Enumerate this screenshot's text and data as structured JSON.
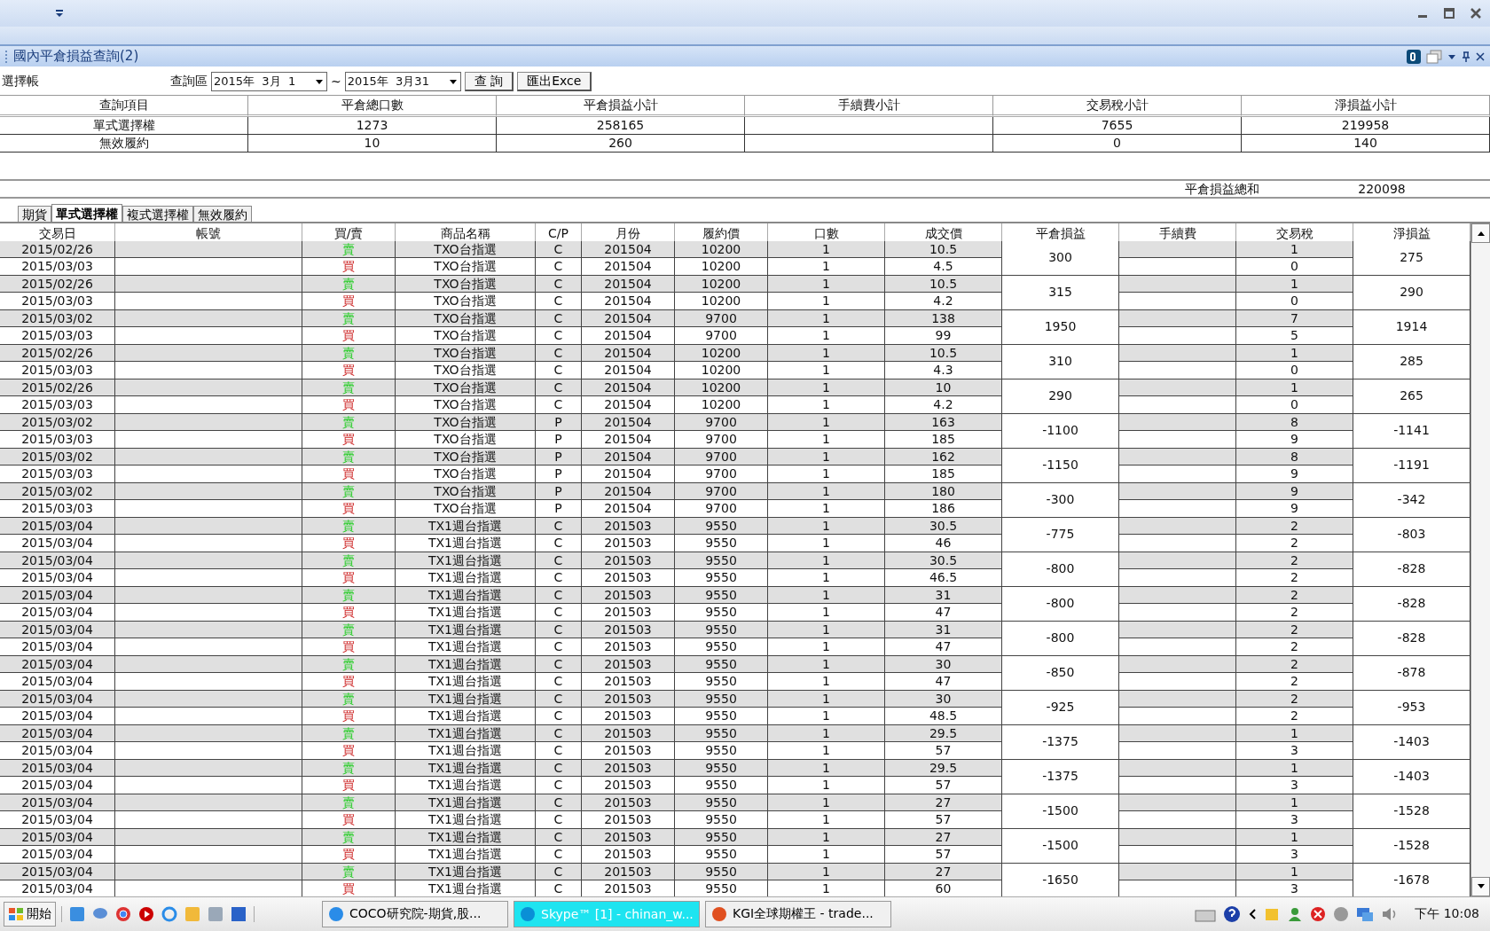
{
  "panel": {
    "title": "國內平倉損益查詢(2)"
  },
  "filter": {
    "account_label": "選擇帳",
    "range_label": "查詢區",
    "date_from": "2015年  3月  1",
    "range_sep": "~",
    "date_to": "2015年  3月31",
    "query_button": "查 詢",
    "export_button": "匯出Exce"
  },
  "summary": {
    "columns": [
      "查詢項目",
      "平倉總口數",
      "平倉損益小計",
      "手續費小計",
      "交易稅小計",
      "淨損益小計"
    ],
    "rows": [
      {
        "item": "單式選擇權",
        "lots": "1273",
        "pl": "258165",
        "tax": "7655",
        "net": "219958"
      },
      {
        "item": "無效履約",
        "lots": "10",
        "pl": "260",
        "tax": "0",
        "net": "140"
      }
    ]
  },
  "total": {
    "label": "平倉損益總和",
    "value": "220098"
  },
  "tabs": [
    {
      "label": "期貨",
      "selected": false
    },
    {
      "label": "單式選擇權",
      "selected": true
    },
    {
      "label": "複式選擇權",
      "selected": false
    },
    {
      "label": "無效履約",
      "selected": false
    }
  ],
  "detail": {
    "columns": [
      "交易日",
      "帳號",
      "買/賣",
      "商品名稱",
      "C/P",
      "月份",
      "履約價",
      "口數",
      "成交價",
      "平倉損益",
      "手續費",
      "交易稅",
      "淨損益"
    ],
    "pairs": [
      {
        "pl": "300",
        "net": "275",
        "legs": [
          {
            "date": "2015/02/26",
            "side": "賣",
            "kind": "sell",
            "product": "TXO台指選",
            "cp": "C",
            "month": "201504",
            "strike": "10200",
            "qty": "1",
            "price": "10.5",
            "tax": "1"
          },
          {
            "date": "2015/03/03",
            "side": "買",
            "kind": "buy",
            "product": "TXO台指選",
            "cp": "C",
            "month": "201504",
            "strike": "10200",
            "qty": "1",
            "price": "4.5",
            "tax": "0"
          }
        ]
      },
      {
        "pl": "315",
        "net": "290",
        "legs": [
          {
            "date": "2015/02/26",
            "side": "賣",
            "kind": "sell",
            "product": "TXO台指選",
            "cp": "C",
            "month": "201504",
            "strike": "10200",
            "qty": "1",
            "price": "10.5",
            "tax": "1"
          },
          {
            "date": "2015/03/03",
            "side": "買",
            "kind": "buy",
            "product": "TXO台指選",
            "cp": "C",
            "month": "201504",
            "strike": "10200",
            "qty": "1",
            "price": "4.2",
            "tax": "0"
          }
        ]
      },
      {
        "pl": "1950",
        "net": "1914",
        "legs": [
          {
            "date": "2015/03/02",
            "side": "賣",
            "kind": "sell",
            "product": "TXO台指選",
            "cp": "C",
            "month": "201504",
            "strike": "9700",
            "qty": "1",
            "price": "138",
            "tax": "7"
          },
          {
            "date": "2015/03/03",
            "side": "買",
            "kind": "buy",
            "product": "TXO台指選",
            "cp": "C",
            "month": "201504",
            "strike": "9700",
            "qty": "1",
            "price": "99",
            "tax": "5"
          }
        ]
      },
      {
        "pl": "310",
        "net": "285",
        "legs": [
          {
            "date": "2015/02/26",
            "side": "賣",
            "kind": "sell",
            "product": "TXO台指選",
            "cp": "C",
            "month": "201504",
            "strike": "10200",
            "qty": "1",
            "price": "10.5",
            "tax": "1"
          },
          {
            "date": "2015/03/03",
            "side": "買",
            "kind": "buy",
            "product": "TXO台指選",
            "cp": "C",
            "month": "201504",
            "strike": "10200",
            "qty": "1",
            "price": "4.3",
            "tax": "0"
          }
        ]
      },
      {
        "pl": "290",
        "net": "265",
        "legs": [
          {
            "date": "2015/02/26",
            "side": "賣",
            "kind": "sell",
            "product": "TXO台指選",
            "cp": "C",
            "month": "201504",
            "strike": "10200",
            "qty": "1",
            "price": "10",
            "tax": "1"
          },
          {
            "date": "2015/03/03",
            "side": "買",
            "kind": "buy",
            "product": "TXO台指選",
            "cp": "C",
            "month": "201504",
            "strike": "10200",
            "qty": "1",
            "price": "4.2",
            "tax": "0"
          }
        ]
      },
      {
        "pl": "-1100",
        "net": "-1141",
        "legs": [
          {
            "date": "2015/03/02",
            "side": "賣",
            "kind": "sell",
            "product": "TXO台指選",
            "cp": "P",
            "month": "201504",
            "strike": "9700",
            "qty": "1",
            "price": "163",
            "tax": "8"
          },
          {
            "date": "2015/03/03",
            "side": "買",
            "kind": "buy",
            "product": "TXO台指選",
            "cp": "P",
            "month": "201504",
            "strike": "9700",
            "qty": "1",
            "price": "185",
            "tax": "9"
          }
        ]
      },
      {
        "pl": "-1150",
        "net": "-1191",
        "legs": [
          {
            "date": "2015/03/02",
            "side": "賣",
            "kind": "sell",
            "product": "TXO台指選",
            "cp": "P",
            "month": "201504",
            "strike": "9700",
            "qty": "1",
            "price": "162",
            "tax": "8"
          },
          {
            "date": "2015/03/03",
            "side": "買",
            "kind": "buy",
            "product": "TXO台指選",
            "cp": "P",
            "month": "201504",
            "strike": "9700",
            "qty": "1",
            "price": "185",
            "tax": "9"
          }
        ]
      },
      {
        "pl": "-300",
        "net": "-342",
        "legs": [
          {
            "date": "2015/03/02",
            "side": "賣",
            "kind": "sell",
            "product": "TXO台指選",
            "cp": "P",
            "month": "201504",
            "strike": "9700",
            "qty": "1",
            "price": "180",
            "tax": "9"
          },
          {
            "date": "2015/03/03",
            "side": "買",
            "kind": "buy",
            "product": "TXO台指選",
            "cp": "P",
            "month": "201504",
            "strike": "9700",
            "qty": "1",
            "price": "186",
            "tax": "9"
          }
        ]
      },
      {
        "pl": "-775",
        "net": "-803",
        "legs": [
          {
            "date": "2015/03/04",
            "side": "賣",
            "kind": "sell",
            "product": "TX1週台指選",
            "cp": "C",
            "month": "201503",
            "strike": "9550",
            "qty": "1",
            "price": "30.5",
            "tax": "2"
          },
          {
            "date": "2015/03/04",
            "side": "買",
            "kind": "buy",
            "product": "TX1週台指選",
            "cp": "C",
            "month": "201503",
            "strike": "9550",
            "qty": "1",
            "price": "46",
            "tax": "2"
          }
        ]
      },
      {
        "pl": "-800",
        "net": "-828",
        "legs": [
          {
            "date": "2015/03/04",
            "side": "賣",
            "kind": "sell",
            "product": "TX1週台指選",
            "cp": "C",
            "month": "201503",
            "strike": "9550",
            "qty": "1",
            "price": "30.5",
            "tax": "2"
          },
          {
            "date": "2015/03/04",
            "side": "買",
            "kind": "buy",
            "product": "TX1週台指選",
            "cp": "C",
            "month": "201503",
            "strike": "9550",
            "qty": "1",
            "price": "46.5",
            "tax": "2"
          }
        ]
      },
      {
        "pl": "-800",
        "net": "-828",
        "legs": [
          {
            "date": "2015/03/04",
            "side": "賣",
            "kind": "sell",
            "product": "TX1週台指選",
            "cp": "C",
            "month": "201503",
            "strike": "9550",
            "qty": "1",
            "price": "31",
            "tax": "2"
          },
          {
            "date": "2015/03/04",
            "side": "買",
            "kind": "buy",
            "product": "TX1週台指選",
            "cp": "C",
            "month": "201503",
            "strike": "9550",
            "qty": "1",
            "price": "47",
            "tax": "2"
          }
        ]
      },
      {
        "pl": "-800",
        "net": "-828",
        "legs": [
          {
            "date": "2015/03/04",
            "side": "賣",
            "kind": "sell",
            "product": "TX1週台指選",
            "cp": "C",
            "month": "201503",
            "strike": "9550",
            "qty": "1",
            "price": "31",
            "tax": "2"
          },
          {
            "date": "2015/03/04",
            "side": "買",
            "kind": "buy",
            "product": "TX1週台指選",
            "cp": "C",
            "month": "201503",
            "strike": "9550",
            "qty": "1",
            "price": "47",
            "tax": "2"
          }
        ]
      },
      {
        "pl": "-850",
        "net": "-878",
        "legs": [
          {
            "date": "2015/03/04",
            "side": "賣",
            "kind": "sell",
            "product": "TX1週台指選",
            "cp": "C",
            "month": "201503",
            "strike": "9550",
            "qty": "1",
            "price": "30",
            "tax": "2"
          },
          {
            "date": "2015/03/04",
            "side": "買",
            "kind": "buy",
            "product": "TX1週台指選",
            "cp": "C",
            "month": "201503",
            "strike": "9550",
            "qty": "1",
            "price": "47",
            "tax": "2"
          }
        ]
      },
      {
        "pl": "-925",
        "net": "-953",
        "legs": [
          {
            "date": "2015/03/04",
            "side": "賣",
            "kind": "sell",
            "product": "TX1週台指選",
            "cp": "C",
            "month": "201503",
            "strike": "9550",
            "qty": "1",
            "price": "30",
            "tax": "2"
          },
          {
            "date": "2015/03/04",
            "side": "買",
            "kind": "buy",
            "product": "TX1週台指選",
            "cp": "C",
            "month": "201503",
            "strike": "9550",
            "qty": "1",
            "price": "48.5",
            "tax": "2"
          }
        ]
      },
      {
        "pl": "-1375",
        "net": "-1403",
        "legs": [
          {
            "date": "2015/03/04",
            "side": "賣",
            "kind": "sell",
            "product": "TX1週台指選",
            "cp": "C",
            "month": "201503",
            "strike": "9550",
            "qty": "1",
            "price": "29.5",
            "tax": "1"
          },
          {
            "date": "2015/03/04",
            "side": "買",
            "kind": "buy",
            "product": "TX1週台指選",
            "cp": "C",
            "month": "201503",
            "strike": "9550",
            "qty": "1",
            "price": "57",
            "tax": "3"
          }
        ]
      },
      {
        "pl": "-1375",
        "net": "-1403",
        "legs": [
          {
            "date": "2015/03/04",
            "side": "賣",
            "kind": "sell",
            "product": "TX1週台指選",
            "cp": "C",
            "month": "201503",
            "strike": "9550",
            "qty": "1",
            "price": "29.5",
            "tax": "1"
          },
          {
            "date": "2015/03/04",
            "side": "買",
            "kind": "buy",
            "product": "TX1週台指選",
            "cp": "C",
            "month": "201503",
            "strike": "9550",
            "qty": "1",
            "price": "57",
            "tax": "3"
          }
        ]
      },
      {
        "pl": "-1500",
        "net": "-1528",
        "legs": [
          {
            "date": "2015/03/04",
            "side": "賣",
            "kind": "sell",
            "product": "TX1週台指選",
            "cp": "C",
            "month": "201503",
            "strike": "9550",
            "qty": "1",
            "price": "27",
            "tax": "1"
          },
          {
            "date": "2015/03/04",
            "side": "買",
            "kind": "buy",
            "product": "TX1週台指選",
            "cp": "C",
            "month": "201503",
            "strike": "9550",
            "qty": "1",
            "price": "57",
            "tax": "3"
          }
        ]
      },
      {
        "pl": "-1500",
        "net": "-1528",
        "legs": [
          {
            "date": "2015/03/04",
            "side": "賣",
            "kind": "sell",
            "product": "TX1週台指選",
            "cp": "C",
            "month": "201503",
            "strike": "9550",
            "qty": "1",
            "price": "27",
            "tax": "1"
          },
          {
            "date": "2015/03/04",
            "side": "買",
            "kind": "buy",
            "product": "TX1週台指選",
            "cp": "C",
            "month": "201503",
            "strike": "9550",
            "qty": "1",
            "price": "57",
            "tax": "3"
          }
        ]
      },
      {
        "pl": "-1650",
        "net": "-1678",
        "legs": [
          {
            "date": "2015/03/04",
            "side": "賣",
            "kind": "sell",
            "product": "TX1週台指選",
            "cp": "C",
            "month": "201503",
            "strike": "9550",
            "qty": "1",
            "price": "27",
            "tax": "1"
          },
          {
            "date": "2015/03/04",
            "side": "買",
            "kind": "buy",
            "product": "TX1週台指選",
            "cp": "C",
            "month": "201503",
            "strike": "9550",
            "qty": "1",
            "price": "60",
            "tax": "3"
          }
        ]
      }
    ]
  },
  "taskbar": {
    "start": "開始",
    "tasks": [
      {
        "label": "COCO研究院-期貨,股...",
        "highlighted": false
      },
      {
        "label": "Skype™ [1] - chinan_w...",
        "highlighted": true
      },
      {
        "label": "KGI全球期權王 - trade...",
        "highlighted": false
      }
    ],
    "clock": "下午 10:08"
  }
}
